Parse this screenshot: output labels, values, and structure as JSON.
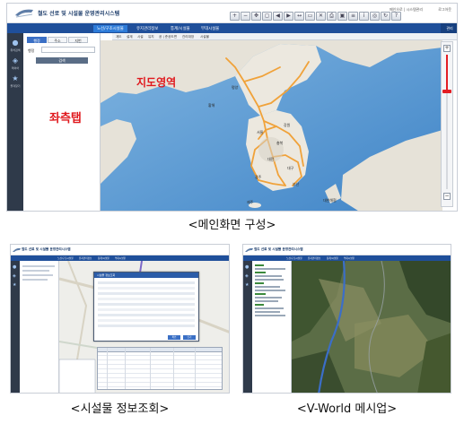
{
  "main": {
    "app_title": "철도 선로 및 시설물 운영관리시스템",
    "header_links": "메인으로  |  시스템관리 ",
    "user_text": "로그아웃",
    "toolbar_icons": [
      "zoom-in-icon",
      "zoom-out-icon",
      "pan-icon",
      "full-extent-icon",
      "prev-extent-icon",
      "next-extent-icon",
      "distance-icon",
      "area-icon",
      "clear-icon",
      "print-icon",
      "save-icon",
      "layer-icon",
      "info-icon",
      "overview-icon",
      "refresh-icon",
      "help-icon"
    ],
    "nav_items": [
      "노선/구조시설물",
      "유지관리정보",
      "통계/시설물",
      "부대시설물"
    ],
    "nav_right": "관리",
    "subnav_items": [
      "계도",
      "설계",
      "시설",
      "유지",
      "공 | 준공도면",
      "관리대장",
      "시설물"
    ],
    "side_icons": [
      {
        "icon": "map-pin-icon",
        "label": "위치검색"
      },
      {
        "icon": "layers-icon",
        "label": "레이어"
      },
      {
        "icon": "star-icon",
        "label": "즐겨찾기"
      }
    ],
    "tabs": [
      "행정",
      "주소",
      "지번"
    ],
    "field_label": "행정",
    "search_button": "검색",
    "left_tab_label": "좌측탭",
    "map_area_label": "지도영역",
    "map_place_labels": [
      "평양",
      "황해",
      "서울",
      "강원",
      "충북",
      "대전",
      "대구",
      "광주",
      "부산",
      "제주",
      "대한해협"
    ],
    "zoom_level_fraction": 0.27
  },
  "caption_main": "<메인화면 구성>",
  "info": {
    "app_title": "철도 선로 및 시설물 운영관리시스템",
    "nav_items": [
      "노선/구조시설물",
      "유지관리정보",
      "통계/시설물",
      "부대시설물"
    ],
    "popup_title": "시설물 정보조회",
    "popup_buttons": [
      "확인",
      "닫기"
    ]
  },
  "caption_info": "<시설물 정보조회>",
  "vworld": {
    "app_title": "철도 선로 및 시설물 운영관리시스템",
    "nav_items": [
      "노선/구조시설물",
      "유지관리정보",
      "통계/시설물",
      "부대시설물"
    ]
  },
  "caption_vworld": "<V-World 메시업>",
  "colors": {
    "nav_blue": "#1f4f9a",
    "accent_red": "#e0181d",
    "sea_blue": "#4f93cf",
    "land": "#e9e5dc"
  }
}
